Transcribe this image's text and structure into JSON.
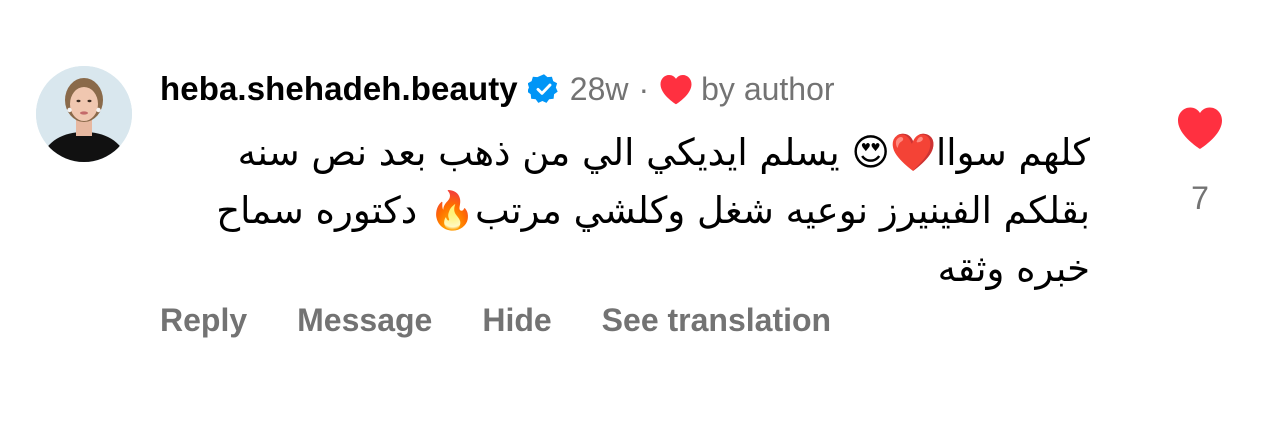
{
  "comment": {
    "username": "heba.shehadeh.beauty",
    "time_ago": "28w",
    "separator": "·",
    "liked_by_author_label": "by author",
    "text_lines": [
      "كلهم سواا❤️😍 يسلم ايديكي الي من ذهب بعد نص سنه",
      "بقلكم الفينيرز نوعيه شغل وكلشي مرتب🔥 دكتوره سماح",
      "خبره وثقه"
    ],
    "actions": {
      "reply": "Reply",
      "message": "Message",
      "hide": "Hide",
      "see_translation": "See translation"
    },
    "like_count": "7"
  },
  "icons": {
    "verified": "verified-badge-icon",
    "author_heart": "heart-filled-icon",
    "like": "heart-filled-icon"
  },
  "colors": {
    "heart_red": "#ff3040",
    "verified_blue": "#0095f6",
    "secondary_text": "#737373",
    "primary_text": "#000000"
  }
}
